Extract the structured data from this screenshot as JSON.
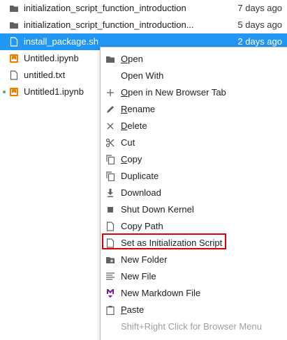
{
  "files": [
    {
      "name": "initialization_script_function_introduction",
      "date": "7 days ago",
      "icon": "folder-icon"
    },
    {
      "name": "initialization_script_function_introduction...",
      "date": "5 days ago",
      "icon": "folder-icon"
    },
    {
      "name": "install_package.sh",
      "date": "2 days ago",
      "icon": "file-icon",
      "selected": true
    },
    {
      "name": "Untitled.ipynb",
      "date": "",
      "icon": "notebook-icon"
    },
    {
      "name": "untitled.txt",
      "date": "",
      "icon": "file-icon"
    },
    {
      "name": "Untitled1.ipynb",
      "date": "",
      "icon": "notebook-icon",
      "running": true
    }
  ],
  "menu": [
    {
      "label": "Open",
      "icon": "folder-icon"
    },
    {
      "label": "Open With",
      "icon": ""
    },
    {
      "label": "Open in New Browser Tab",
      "icon": "plus-icon"
    },
    {
      "label": "Rename",
      "icon": "pencil-icon"
    },
    {
      "label": "Delete",
      "icon": "close-icon"
    },
    {
      "label": "Cut",
      "icon": "scissors-icon"
    },
    {
      "label": "Copy",
      "icon": "copy-icon"
    },
    {
      "label": "Duplicate",
      "icon": "copy-icon"
    },
    {
      "label": "Download",
      "icon": "download-icon"
    },
    {
      "label": "Shut Down Kernel",
      "icon": "stop-icon"
    },
    {
      "label": "Copy Path",
      "icon": "file-icon"
    },
    {
      "label": "Set as Initialization Script",
      "icon": "file-icon"
    },
    {
      "label": "New Folder",
      "icon": "new-folder-icon"
    },
    {
      "label": "New File",
      "icon": "text-file-icon"
    },
    {
      "label": "New Markdown File",
      "icon": "markdown-icon"
    },
    {
      "label": "Paste",
      "icon": "clipboard-icon"
    },
    {
      "label": "Shift+Right Click for Browser Menu",
      "icon": ""
    }
  ],
  "colors": {
    "selection": "#2196f3",
    "highlight_box": "#e00000",
    "notebook": "#f57c00",
    "markdown": "#7b1fa2"
  }
}
